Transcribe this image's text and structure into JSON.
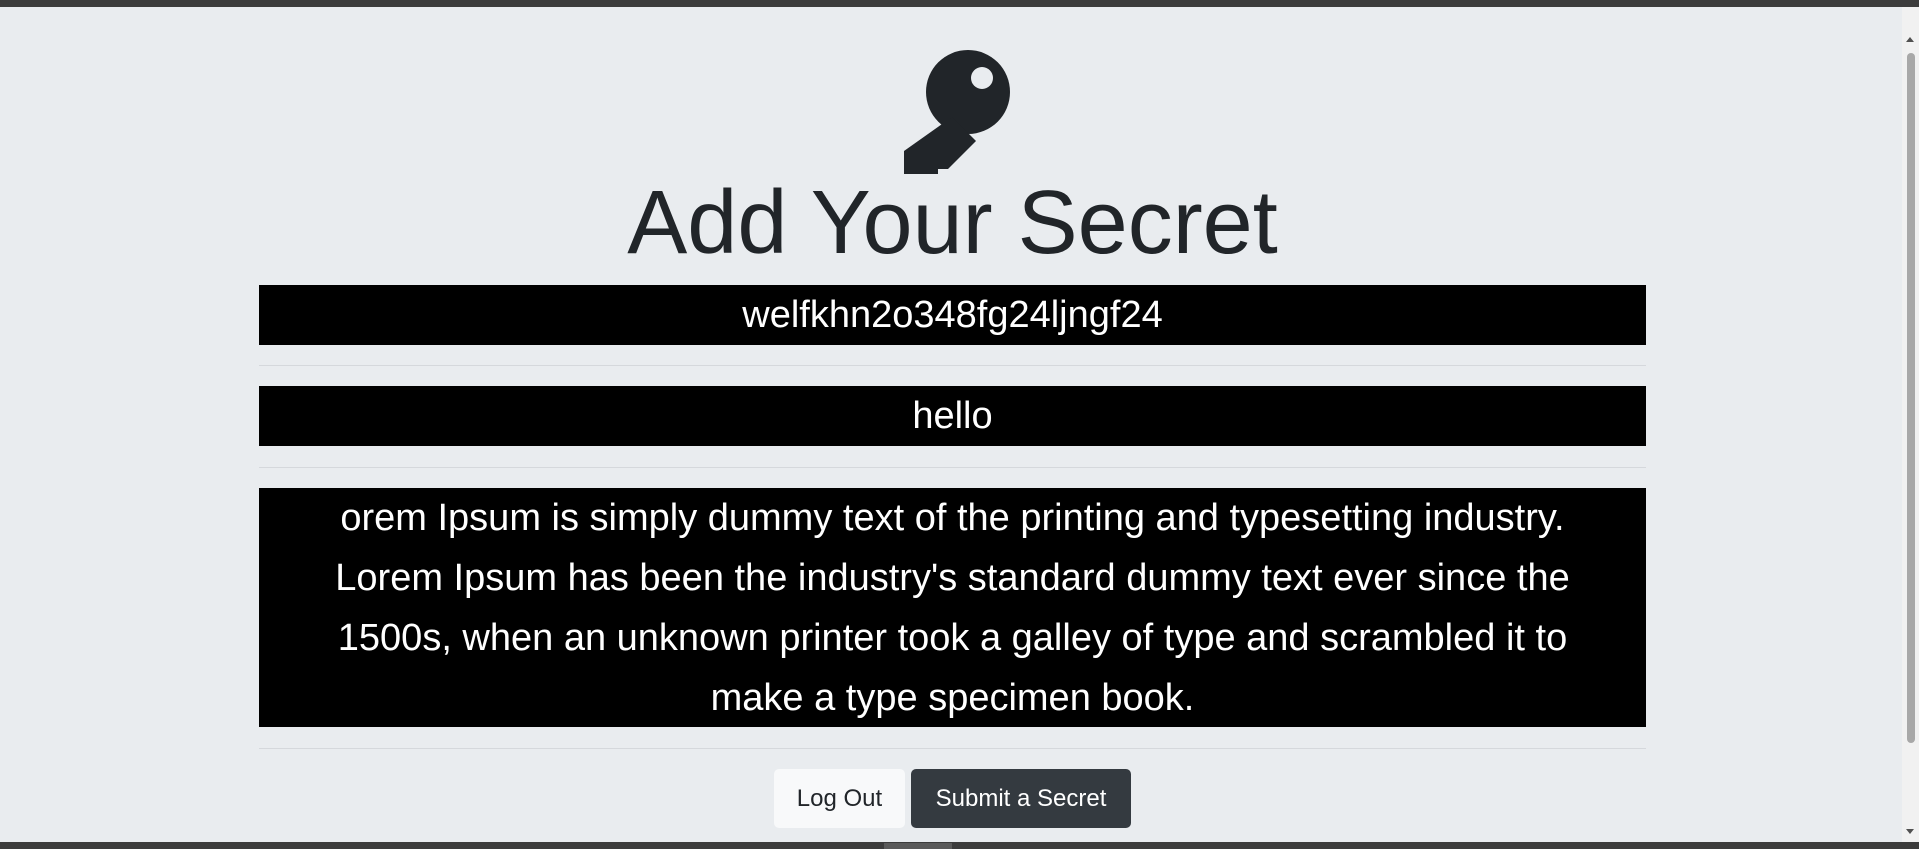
{
  "page": {
    "title": "Add Your Secret",
    "icon": "key-icon",
    "background": "#e9ecef"
  },
  "secrets": [
    "welfkhn2o348fg24ljngf24",
    "hello",
    "orem Ipsum is simply dummy text of the printing and typesetting industry. Lorem Ipsum has been the industry's standard dummy text ever since the 1500s, when an unknown printer took a galley of type and scrambled it to make a type specimen book."
  ],
  "buttons": {
    "logout_label": "Log Out",
    "submit_label": "Submit a Secret"
  },
  "colors": {
    "secret_bg": "#000000",
    "secret_text": "#ffffff",
    "dark_button": "#343a40",
    "light_button": "#f8f9fa"
  }
}
